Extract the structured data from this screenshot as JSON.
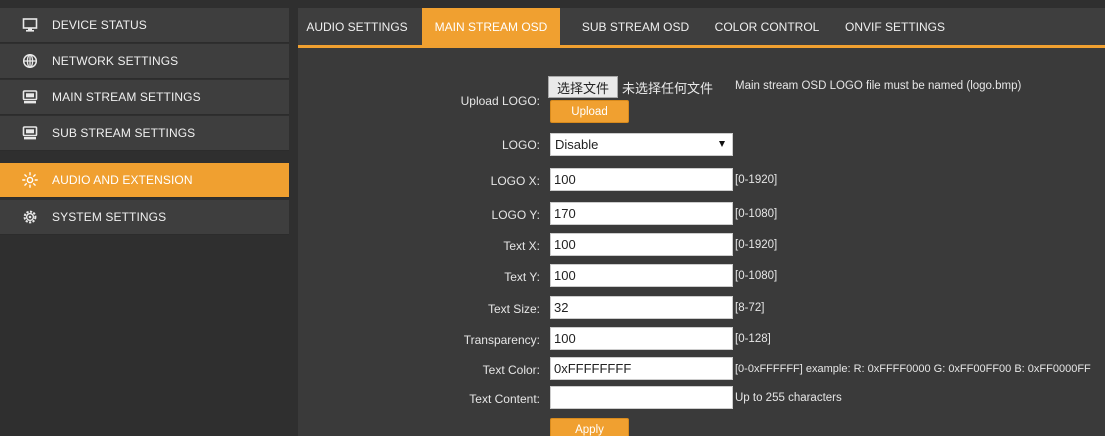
{
  "sidebar": {
    "items": [
      {
        "label": "DEVICE STATUS",
        "icon": "monitor-icon"
      },
      {
        "label": "NETWORK SETTINGS",
        "icon": "globe-icon"
      },
      {
        "label": "MAIN STREAM SETTINGS",
        "icon": "display-icon"
      },
      {
        "label": "SUB STREAM SETTINGS",
        "icon": "display-icon"
      },
      {
        "label": "AUDIO AND EXTENSION",
        "icon": "audio-extension-icon"
      },
      {
        "label": "SYSTEM SETTINGS",
        "icon": "gear-icon"
      }
    ],
    "active_index": 4
  },
  "tabs": [
    {
      "label": "AUDIO SETTINGS"
    },
    {
      "label": "MAIN STREAM OSD"
    },
    {
      "label": "SUB STREAM OSD"
    },
    {
      "label": "COLOR CONTROL"
    },
    {
      "label": "ONVIF SETTINGS"
    }
  ],
  "active_tab": 1,
  "form": {
    "upload_logo": {
      "label": "Upload LOGO:",
      "file_button": "选择文件",
      "file_status": "未选择任何文件",
      "note": "Main stream OSD LOGO file must be named (logo.bmp)",
      "upload_button": "Upload"
    },
    "logo": {
      "label": "LOGO:",
      "value": "Disable"
    },
    "logo_x": {
      "label": "LOGO X:",
      "value": "100",
      "range": "[0-1920]"
    },
    "logo_y": {
      "label": "LOGO Y:",
      "value": "170",
      "range": "[0-1080]"
    },
    "text_x": {
      "label": "Text X:",
      "value": "100",
      "range": "[0-1920]"
    },
    "text_y": {
      "label": "Text Y:",
      "value": "100",
      "range": "[0-1080]"
    },
    "text_size": {
      "label": "Text Size:",
      "value": "32",
      "range": "[8-72]"
    },
    "transparency": {
      "label": "Transparency:",
      "value": "100",
      "range": "[0-128]"
    },
    "text_color": {
      "label": "Text Color:",
      "value": "0xFFFFFFFF",
      "range": "[0-0xFFFFFF] example: R: 0xFFFF0000 G: 0xFF00FF00 B: 0xFF0000FF"
    },
    "text_content": {
      "label": "Text Content:",
      "value": "",
      "range": "Up to 255 characters"
    },
    "apply_button": "Apply"
  },
  "colors": {
    "accent": "#f0a030",
    "sidebar_bg": "#3e3e3e",
    "content_bg": "#3a3a3a",
    "page_bg": "#2f2f2f"
  }
}
